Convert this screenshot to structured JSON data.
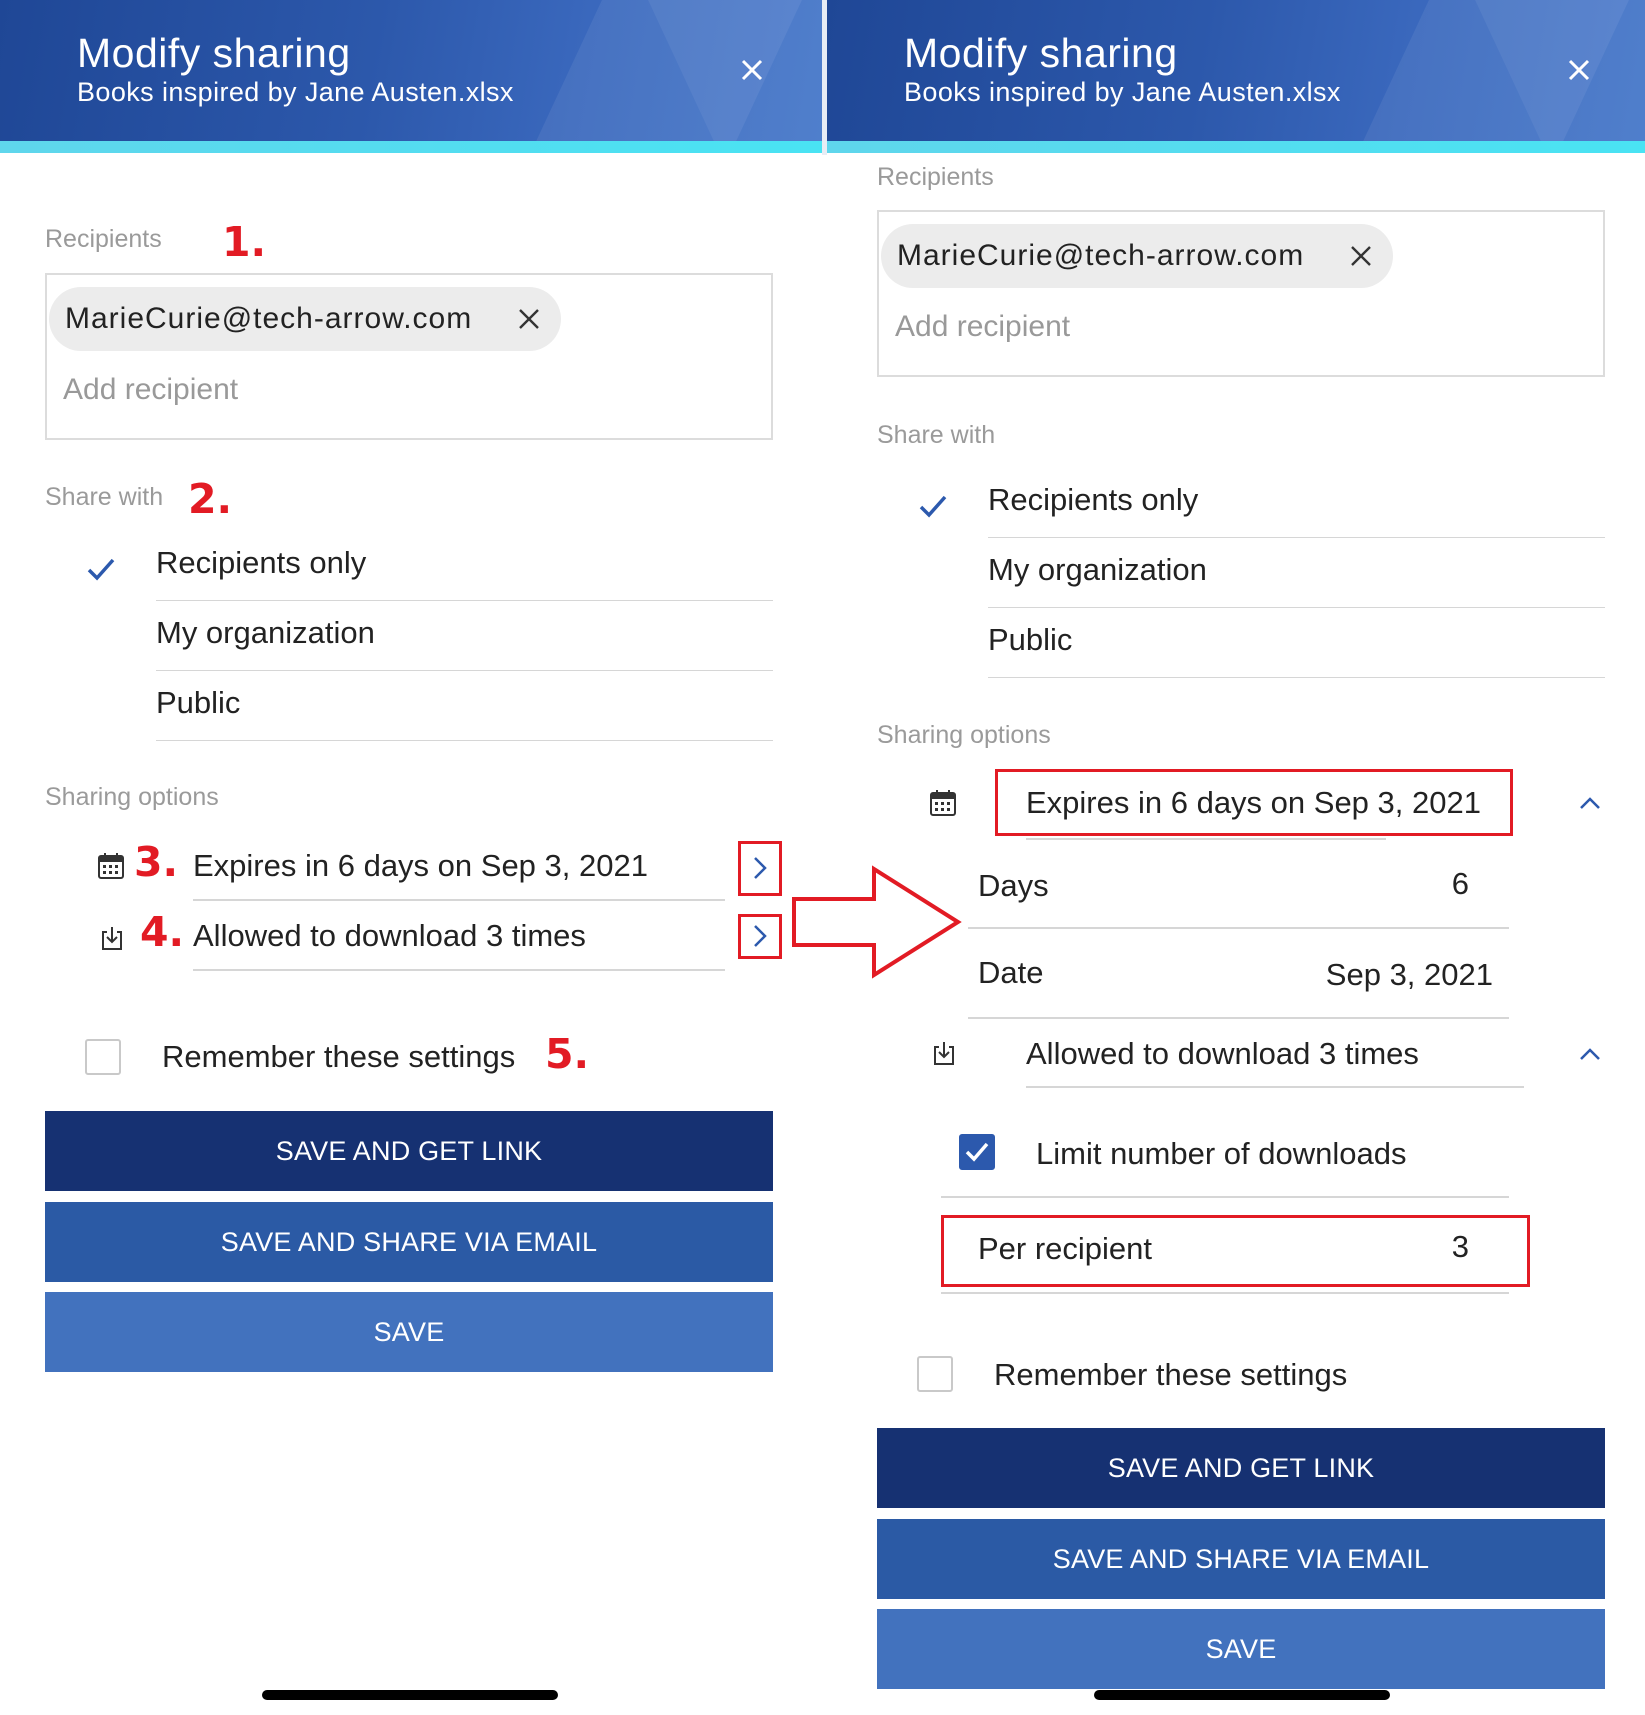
{
  "dialog": {
    "title": "Modify sharing",
    "file_name": "Books inspired by Jane Austen.xlsx"
  },
  "recipients": {
    "label": "Recipients",
    "chips": [
      "MarieCurie@tech-arrow.com"
    ],
    "placeholder": "Add recipient"
  },
  "share_with": {
    "label": "Share with",
    "options": [
      "Recipients only",
      "My organization",
      "Public"
    ],
    "selected": "Recipients only"
  },
  "sharing_options": {
    "label": "Sharing options",
    "expiry": "Expires in 6 days on Sep 3, 2021",
    "download": "Allowed to download 3 times",
    "days_label": "Days",
    "days_value": "6",
    "date_label": "Date",
    "date_value": "Sep 3, 2021",
    "limit_label": "Limit number of downloads",
    "limit_checked": true,
    "per_recipient_label": "Per recipient",
    "per_recipient_value": "3"
  },
  "remember": {
    "label": "Remember these settings",
    "checked": false
  },
  "buttons": {
    "save_get_link": "SAVE AND GET LINK",
    "save_share_email": "SAVE AND SHARE VIA EMAIL",
    "save": "SAVE"
  },
  "annotations": [
    "1.",
    "2.",
    "3.",
    "4.",
    "5."
  ],
  "colors": {
    "header": "#2c58ab",
    "accent_stripe": "#4fe0f2",
    "button_dark": "#163172",
    "button_mid": "#2b5aa5",
    "button_light": "#4272be",
    "annotation_red": "#e21b24"
  },
  "icons": [
    "close-icon",
    "remove-chip-icon",
    "check-icon",
    "calendar-icon",
    "download-icon",
    "chevron-right-icon",
    "chevron-up-icon",
    "arrow-icon"
  ]
}
